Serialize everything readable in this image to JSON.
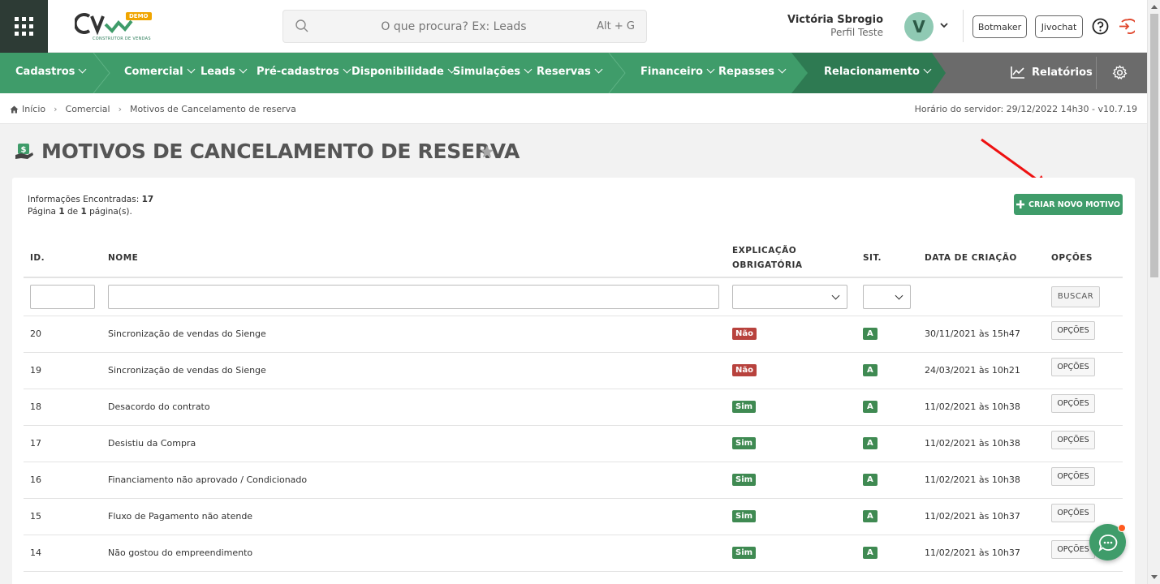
{
  "header": {
    "logo_demo": "DEMO",
    "logo_sub": "CONSTRUTOR DE VENDAS",
    "search_placeholder": "O que procura? Ex: Leads",
    "search_shortcut": "Alt + G",
    "user_name": "Victória Sbrogio",
    "user_profile": "Perfil Teste",
    "avatar_letter": "V",
    "botmaker_label": "Botmaker",
    "jivochat_label": "Jivochat"
  },
  "nav": {
    "items": [
      {
        "label": "Cadastros"
      },
      {
        "label": "Comercial"
      },
      {
        "label": "Leads"
      },
      {
        "label": "Pré-cadastros"
      },
      {
        "label": "Disponibilidade"
      },
      {
        "label": "Simulações"
      },
      {
        "label": "Reservas"
      },
      {
        "label": "Financeiro"
      },
      {
        "label": "Repasses"
      },
      {
        "label": "Relacionamento"
      }
    ],
    "reports_label": "Relatórios",
    "colors": {
      "primary": "#3f9c6a",
      "dark": "#2e7a52",
      "gray": "#6b6b6b"
    }
  },
  "breadcrumb": {
    "items": [
      "Início",
      "Comercial",
      "Motivos de Cancelamento de reserva"
    ],
    "server_time": "Horário do servidor: 29/12/2022 14h30 - v10.7.19"
  },
  "page": {
    "title": "MOTIVOS DE CANCELAMENTO DE RESERVA",
    "info_found_label": "Informações Encontradas:",
    "info_found_count": "17",
    "info_page_prefix": "Página",
    "info_page_num": "1",
    "info_page_of": "de",
    "info_page_total": "1",
    "info_page_suffix": "página(s).",
    "create_button": "CRIAR NOVO MOTIVO"
  },
  "table": {
    "headers": {
      "id": "ID.",
      "nome": "NOME",
      "explicacao_1": "EXPLICAÇÃO",
      "explicacao_2": "OBRIGATÓRIA",
      "sit": "SIT.",
      "data": "DATA DE CRIAÇÃO",
      "opcoes": "OPÇÕES"
    },
    "search_button": "BUSCAR",
    "options_label": "OPÇÕES",
    "rows": [
      {
        "id": "20",
        "nome": "Sincronização de vendas do Sienge",
        "explicacao": "Não",
        "sit": "A",
        "data": "30/11/2021 às 15h47"
      },
      {
        "id": "19",
        "nome": "Sincronização de vendas do Sienge",
        "explicacao": "Não",
        "sit": "A",
        "data": "24/03/2021 às 10h21"
      },
      {
        "id": "18",
        "nome": "Desacordo do contrato",
        "explicacao": "Sim",
        "sit": "A",
        "data": "11/02/2021 às 10h38"
      },
      {
        "id": "17",
        "nome": "Desistiu da Compra",
        "explicacao": "Sim",
        "sit": "A",
        "data": "11/02/2021 às 10h38"
      },
      {
        "id": "16",
        "nome": "Financiamento não aprovado / Condicionado",
        "explicacao": "Sim",
        "sit": "A",
        "data": "11/02/2021 às 10h38"
      },
      {
        "id": "15",
        "nome": "Fluxo de Pagamento não atende",
        "explicacao": "Sim",
        "sit": "A",
        "data": "11/02/2021 às 10h37"
      },
      {
        "id": "14",
        "nome": "Não gostou do empreendimento",
        "explicacao": "Sim",
        "sit": "A",
        "data": "11/02/2021 às 10h37"
      }
    ]
  }
}
